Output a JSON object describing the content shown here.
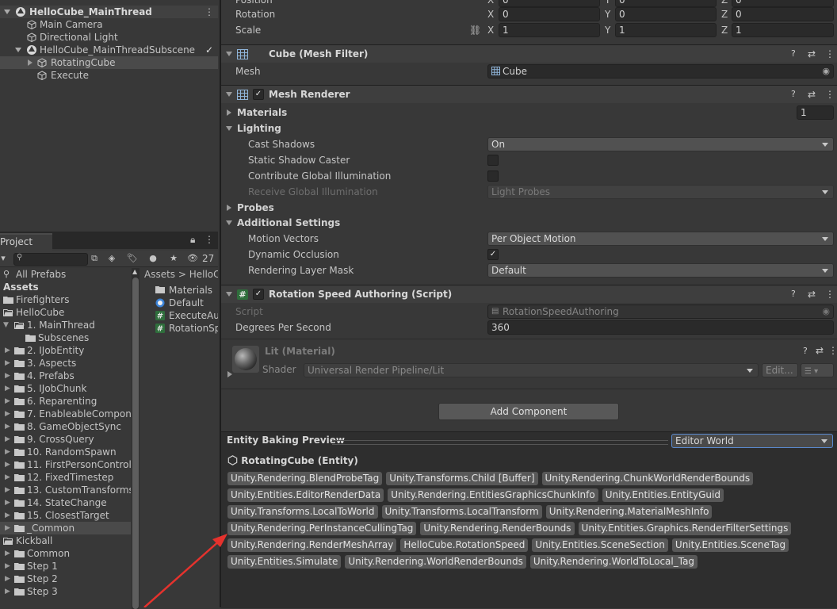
{
  "hierarchy": {
    "scene1": "HelloCube_MainThread",
    "items1": [
      "Main Camera",
      "Directional Light"
    ],
    "subscene": "HelloCube_MainThreadSubscene",
    "items2": [
      "RotatingCube",
      "Execute"
    ]
  },
  "project": {
    "tab_label": "Project",
    "search_placeholder": "",
    "hidden_count": "27",
    "tree": [
      {
        "label": "All Prefabs",
        "level": 0,
        "arrow": "",
        "icon": "search"
      },
      {
        "label": "Assets",
        "level": 0,
        "arrow": "down",
        "icon": "none",
        "bold": true
      },
      {
        "label": "Firefighters",
        "level": 0,
        "arrow": "",
        "icon": "folder"
      },
      {
        "label": "HelloCube",
        "level": 0,
        "arrow": "",
        "icon": "folder-open"
      },
      {
        "label": "1. MainThread",
        "level": 1,
        "arrow": "down",
        "icon": "folder-open"
      },
      {
        "label": "Subscenes",
        "level": 2,
        "arrow": "",
        "icon": "folder"
      },
      {
        "label": "2. IJobEntity",
        "level": 1,
        "arrow": "right",
        "icon": "folder"
      },
      {
        "label": "3. Aspects",
        "level": 1,
        "arrow": "right",
        "icon": "folder"
      },
      {
        "label": "4. Prefabs",
        "level": 1,
        "arrow": "right",
        "icon": "folder"
      },
      {
        "label": "5. IJobChunk",
        "level": 1,
        "arrow": "right",
        "icon": "folder"
      },
      {
        "label": "6. Reparenting",
        "level": 1,
        "arrow": "right",
        "icon": "folder"
      },
      {
        "label": "7. EnableableCompone",
        "level": 1,
        "arrow": "right",
        "icon": "folder"
      },
      {
        "label": "8. GameObjectSync",
        "level": 1,
        "arrow": "right",
        "icon": "folder"
      },
      {
        "label": "9. CrossQuery",
        "level": 1,
        "arrow": "right",
        "icon": "folder"
      },
      {
        "label": "10. RandomSpawn",
        "level": 1,
        "arrow": "right",
        "icon": "folder"
      },
      {
        "label": "11. FirstPersonControlle",
        "level": 1,
        "arrow": "right",
        "icon": "folder"
      },
      {
        "label": "12. FixedTimestep",
        "level": 1,
        "arrow": "right",
        "icon": "folder"
      },
      {
        "label": "13. CustomTransforms",
        "level": 1,
        "arrow": "right",
        "icon": "folder"
      },
      {
        "label": "14. StateChange",
        "level": 1,
        "arrow": "right",
        "icon": "folder"
      },
      {
        "label": "15. ClosestTarget",
        "level": 1,
        "arrow": "right",
        "icon": "folder"
      },
      {
        "label": "_Common",
        "level": 1,
        "arrow": "right",
        "icon": "folder",
        "sel": true
      },
      {
        "label": "Kickball",
        "level": 0,
        "arrow": "",
        "icon": "folder-open"
      },
      {
        "label": "Common",
        "level": 1,
        "arrow": "right",
        "icon": "folder"
      },
      {
        "label": "Step 1",
        "level": 1,
        "arrow": "right",
        "icon": "folder"
      },
      {
        "label": "Step 2",
        "level": 1,
        "arrow": "right",
        "icon": "folder"
      },
      {
        "label": "Step 3",
        "level": 1,
        "arrow": "right",
        "icon": "folder"
      }
    ],
    "breadcrumb": "Assets > HelloC",
    "files": [
      {
        "label": "Materials",
        "icon": "folder"
      },
      {
        "label": "Default",
        "icon": "scene"
      },
      {
        "label": "ExecuteAu",
        "icon": "script"
      },
      {
        "label": "RotationSp",
        "icon": "script"
      }
    ]
  },
  "transform": {
    "position_label": "Position",
    "rotation_label": "Rotation",
    "scale_label": "Scale",
    "position": [
      "0",
      "0",
      "0"
    ],
    "rotation": [
      "0",
      "0",
      "0"
    ],
    "scale": [
      "1",
      "1",
      "1"
    ],
    "axes": [
      "X",
      "Y",
      "Z"
    ]
  },
  "mesh_filter": {
    "title": "Cube (Mesh Filter)",
    "mesh_label": "Mesh",
    "mesh_value": "Cube"
  },
  "mesh_renderer": {
    "title": "Mesh Renderer",
    "materials_label": "Materials",
    "materials_count": "1",
    "lighting_label": "Lighting",
    "cast_shadows_label": "Cast Shadows",
    "cast_shadows_value": "On",
    "static_shadow_caster_label": "Static Shadow Caster",
    "contribute_gi_label": "Contribute Global Illumination",
    "receive_gi_label": "Receive Global Illumination",
    "receive_gi_value": "Light Probes",
    "probes_label": "Probes",
    "additional_label": "Additional Settings",
    "motion_vectors_label": "Motion Vectors",
    "motion_vectors_value": "Per Object Motion",
    "dynamic_occlusion_label": "Dynamic Occlusion",
    "rendering_layer_label": "Rendering Layer Mask",
    "rendering_layer_value": "Default"
  },
  "rotation_speed": {
    "title": "Rotation Speed Authoring (Script)",
    "script_label": "Script",
    "script_value": "RotationSpeedAuthoring",
    "dps_label": "Degrees Per Second",
    "dps_value": "360"
  },
  "material": {
    "title": "Lit (Material)",
    "shader_label": "Shader",
    "shader_value": "Universal Render Pipeline/Lit",
    "edit_label": "Edit..."
  },
  "add_component_label": "Add Component",
  "baking": {
    "title": "Entity Baking Preview",
    "world": "Editor World",
    "entity": "RotatingCube (Entity)",
    "components": [
      [
        "Unity.Rendering.BlendProbeTag",
        "Unity.Transforms.Child [Buffer]",
        "Unity.Rendering.ChunkWorldRenderBounds"
      ],
      [
        "Unity.Entities.EditorRenderData",
        "Unity.Rendering.EntitiesGraphicsChunkInfo",
        "Unity.Entities.EntityGuid"
      ],
      [
        "Unity.Transforms.LocalToWorld",
        "Unity.Transforms.LocalTransform",
        "Unity.Rendering.MaterialMeshInfo"
      ],
      [
        "Unity.Rendering.PerInstanceCullingTag",
        "Unity.Rendering.RenderBounds",
        "Unity.Entities.Graphics.RenderFilterSettings"
      ],
      [
        "Unity.Rendering.RenderMeshArray",
        "HelloCube.RotationSpeed",
        "Unity.Entities.SceneSection",
        "Unity.Entities.SceneTag"
      ],
      [
        "Unity.Entities.Simulate",
        "Unity.Rendering.WorldRenderBounds",
        "Unity.Rendering.WorldToLocal_Tag"
      ]
    ]
  },
  "colors": {
    "arrow": "#e5322d",
    "selection": "#4a4a4a",
    "chip": "#585858"
  }
}
